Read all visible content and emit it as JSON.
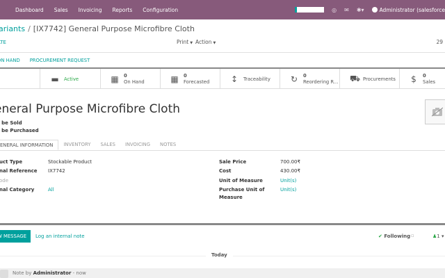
{
  "navbar": {
    "menu": [
      "Dashboard",
      "Sales",
      "Invoicing",
      "Reports",
      "Configuration"
    ],
    "user": "Administrator (salesforce",
    "accent": "#875a7b"
  },
  "control": {
    "breadcrumb_parent": "ariants",
    "breadcrumb_current": "[IX7742] General Purpose Microfibre Cloth",
    "create_label": "ATE",
    "print_label": "Print",
    "action_label": "Action",
    "pager": "29"
  },
  "header_buttons": [
    "ON HAND",
    "PROCUREMENT REQUEST"
  ],
  "smart_buttons": {
    "active": "Active",
    "on_hand": {
      "value": "0",
      "label": "On Hand"
    },
    "forecasted": {
      "value": "0",
      "label": "Forecasted"
    },
    "traceability": "Traceability",
    "reordering": {
      "value": "0",
      "label": "Reordering R..."
    },
    "procurements": "Procurements",
    "sales": {
      "value": "0",
      "label": "Sales"
    }
  },
  "product": {
    "name": "eneral Purpose Microfibre Cloth",
    "can_be_sold": "an be Sold",
    "can_be_purchased": "an be Purchased"
  },
  "tabs": [
    "ENERAL INFORMATION",
    "INVENTORY",
    "SALES",
    "INVOICING",
    "NOTES"
  ],
  "fields_left": {
    "product_type_label": "uct Type",
    "product_type": "Stockable Product",
    "internal_ref_label": "nal Reference",
    "internal_ref": "IX7742",
    "barcode_label": "ode",
    "category_label": "nal Category",
    "category": "All"
  },
  "fields_right": {
    "sale_price_label": "Sale Price",
    "sale_price": "700.00₹",
    "cost_label": "Cost",
    "cost": "430.00₹",
    "uom_label": "Unit of Measure",
    "uom": "Unit(s)",
    "purchase_uom_label_1": "Purchase Unit of",
    "purchase_uom_label_2": "Measure",
    "purchase_uom": "Unit(s)"
  },
  "chatter": {
    "send_message": "W MESSAGE",
    "log_note": "Log an internal note",
    "following": "Following",
    "followers_count": "1",
    "today": "Today",
    "note_prefix": "Note by ",
    "note_author": "Administrator",
    "note_suffix": " - now"
  }
}
